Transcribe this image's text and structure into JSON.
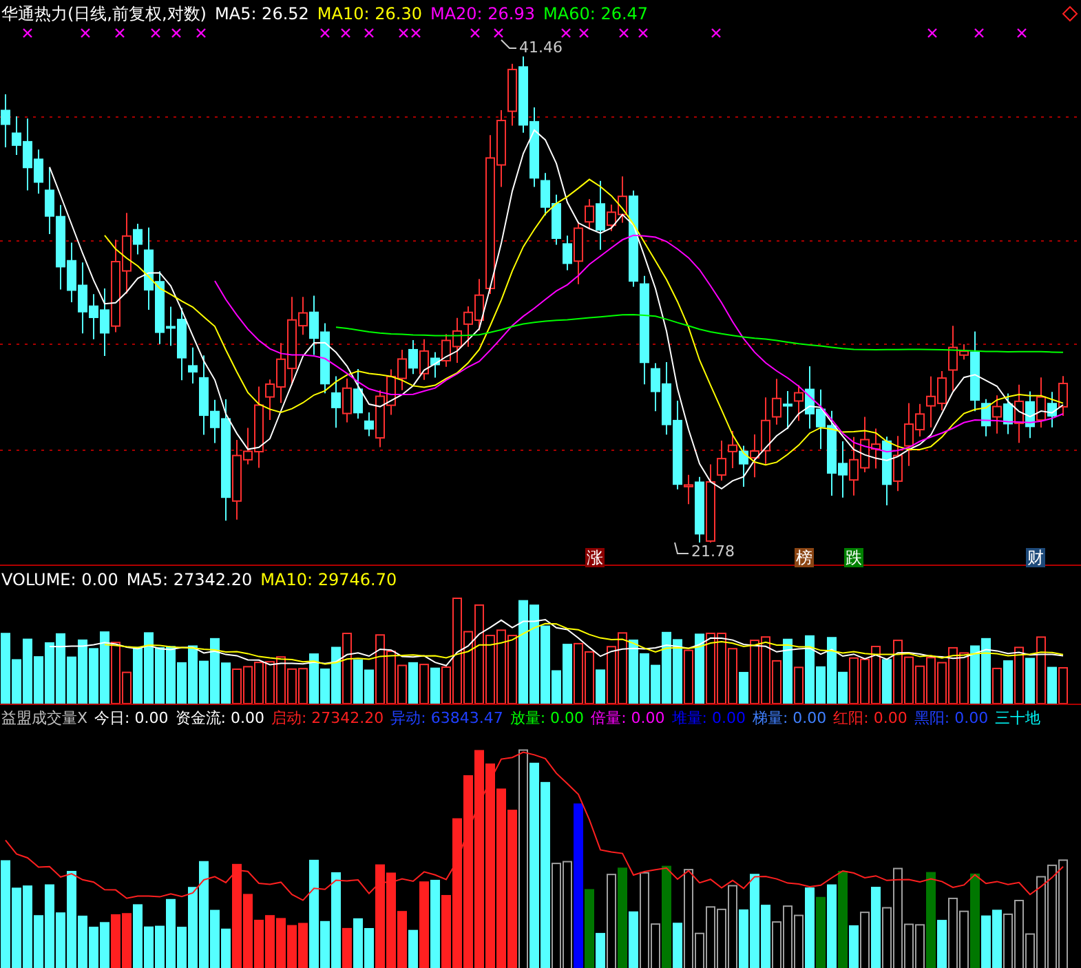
{
  "price_panel": {
    "title": "华通热力(日线,前复权,对数)",
    "indicators": [
      {
        "label": "MA5: 26.52",
        "color": "#ffffff"
      },
      {
        "label": "MA10: 26.30",
        "color": "#ffff00"
      },
      {
        "label": "MA20: 26.93",
        "color": "#ff00ff"
      },
      {
        "label": "MA60: 26.47",
        "color": "#00ff00"
      }
    ],
    "high_label": "41.46",
    "low_label": "21.78",
    "tags": [
      {
        "text": "涨",
        "color": "#8b0000"
      },
      {
        "text": "榜",
        "color": "#8b4513"
      },
      {
        "text": "跌",
        "color": "#008000"
      },
      {
        "text": "财",
        "color": "#1e4a7a"
      }
    ]
  },
  "volume_panel": {
    "indicators": [
      {
        "label": "VOLUME: 0.00",
        "color": "#ffffff"
      },
      {
        "label": "MA5: 27342.20",
        "color": "#ffffff"
      },
      {
        "label": "MA10: 29746.70",
        "color": "#ffff00"
      }
    ]
  },
  "flow_panel": {
    "indicators": [
      {
        "label": "益盟成交量X",
        "color": "#c0c0c0"
      },
      {
        "label": "今日: 0.00",
        "color": "#ffffff"
      },
      {
        "label": "资金流: 0.00",
        "color": "#ffffff"
      },
      {
        "label": "启动: 27342.20",
        "color": "#ff2020"
      },
      {
        "label": "异动: 63843.47",
        "color": "#2040ff"
      },
      {
        "label": "放量: 0.00",
        "color": "#00ff00"
      },
      {
        "label": "倍量: 0.00",
        "color": "#ff00ff"
      },
      {
        "label": "堆量: 0.00",
        "color": "#0000ff"
      },
      {
        "label": "梯量: 0.00",
        "color": "#4080ff"
      },
      {
        "label": "红阳: 0.00",
        "color": "#ff2020"
      },
      {
        "label": "黑阳: 0.00",
        "color": "#2040ff"
      },
      {
        "label": "三十地",
        "color": "#00ffff"
      }
    ]
  }
}
